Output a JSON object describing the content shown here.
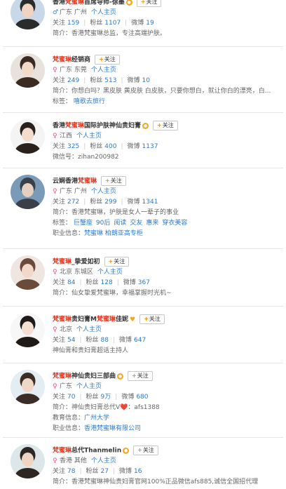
{
  "labels": {
    "follow": "关注",
    "follows": "关注",
    "fans": "粉丝",
    "weibo": "微博",
    "intro": "简介：",
    "tags": "标签：",
    "weixin": "微信号：",
    "edu": "教育信息：",
    "job": "职业信息：",
    "home": "个人主页"
  },
  "users": [
    {
      "name_pre": "香港",
      "name_hl": "梵蜜琳",
      "name_post": "首席导师-徐墨",
      "badge": "vip",
      "gender": "male",
      "location": "广东 广州",
      "follows": "159",
      "fans": "1107",
      "weibo": "19",
      "intro": "香港梵蜜琳总监，专注高端护肤。"
    },
    {
      "name_pre": "",
      "name_hl": "梵蜜琳",
      "name_post": "经销商",
      "badge": "",
      "gender": "female",
      "location": "广东 东莞",
      "follows": "249",
      "fans": "513",
      "weibo": "10",
      "intro": "你想白吗？黑皮肤 黄皮肤 白皮肤，只要你想白，就让你白的漂亮，白...",
      "tags": [
        "嘻歌去旅行"
      ]
    },
    {
      "name_pre": "香港",
      "name_hl": "梵蜜琳",
      "name_post": "国际护肤神仙贵妇膏",
      "badge": "vip",
      "gender": "female",
      "location": "江西",
      "follows": "325",
      "fans": "400",
      "weibo": "1137",
      "weixin": "zihan200982"
    },
    {
      "name_pre": "云娴香港",
      "name_hl": "梵蜜琳",
      "name_post": "",
      "badge": "",
      "gender": "female",
      "location": "广东 广州",
      "follows": "272",
      "fans": "299",
      "weibo": "1341",
      "intro": "香港梵蜜琳，护肤是女人一辈子的事业",
      "tags": [
        "巨蟹座",
        "90后",
        "阅读",
        "交友",
        "惠来",
        "穿衣美容"
      ],
      "job": "梵蜜琳 柏朗亚高专柜"
    },
    {
      "name_pre": "",
      "name_hl": "梵蜜琳",
      "name_post": "_挚爱如初",
      "badge": "",
      "gender": "female",
      "location": "北京 东城区",
      "follows": "84",
      "fans": "128",
      "weibo": "367",
      "intro": "仙女挚爱梵蜜琳，幸福掌握时光机~"
    },
    {
      "name_pre": "",
      "name_hl": "梵蜜琳",
      "name_post": "贵妇膏M",
      "name_hl2": "梵蜜琳",
      "name_post2": "佳妮",
      "badge": "heart",
      "gender": "female",
      "location": "北京",
      "follows": "54",
      "fans": "88",
      "weibo": "647",
      "bio": "神仙膏和贵妇膏超话主持人"
    },
    {
      "name_pre": "",
      "name_hl": "梵蜜琳",
      "name_post": "神仙贵妇三部曲",
      "badge": "vip",
      "gender": "female",
      "location": "广东",
      "follows": "70",
      "fans": "9万",
      "weibo": "680",
      "intro": "神仙贵妇膏总代V❤️：afs1388",
      "edu": "广州大学",
      "job": "香港梵蜜琳有限公司"
    },
    {
      "name_pre": "",
      "name_hl": "梵蜜琳",
      "name_post": "总代Thanmelin",
      "badge": "vip",
      "gender": "female",
      "location": "香港 其他",
      "follows": "78",
      "fans": "27",
      "weibo": "16",
      "intro": "香港梵蜜琳神仙贵妇膏官网100%正品微信afs885,诚信全国招代理"
    }
  ]
}
